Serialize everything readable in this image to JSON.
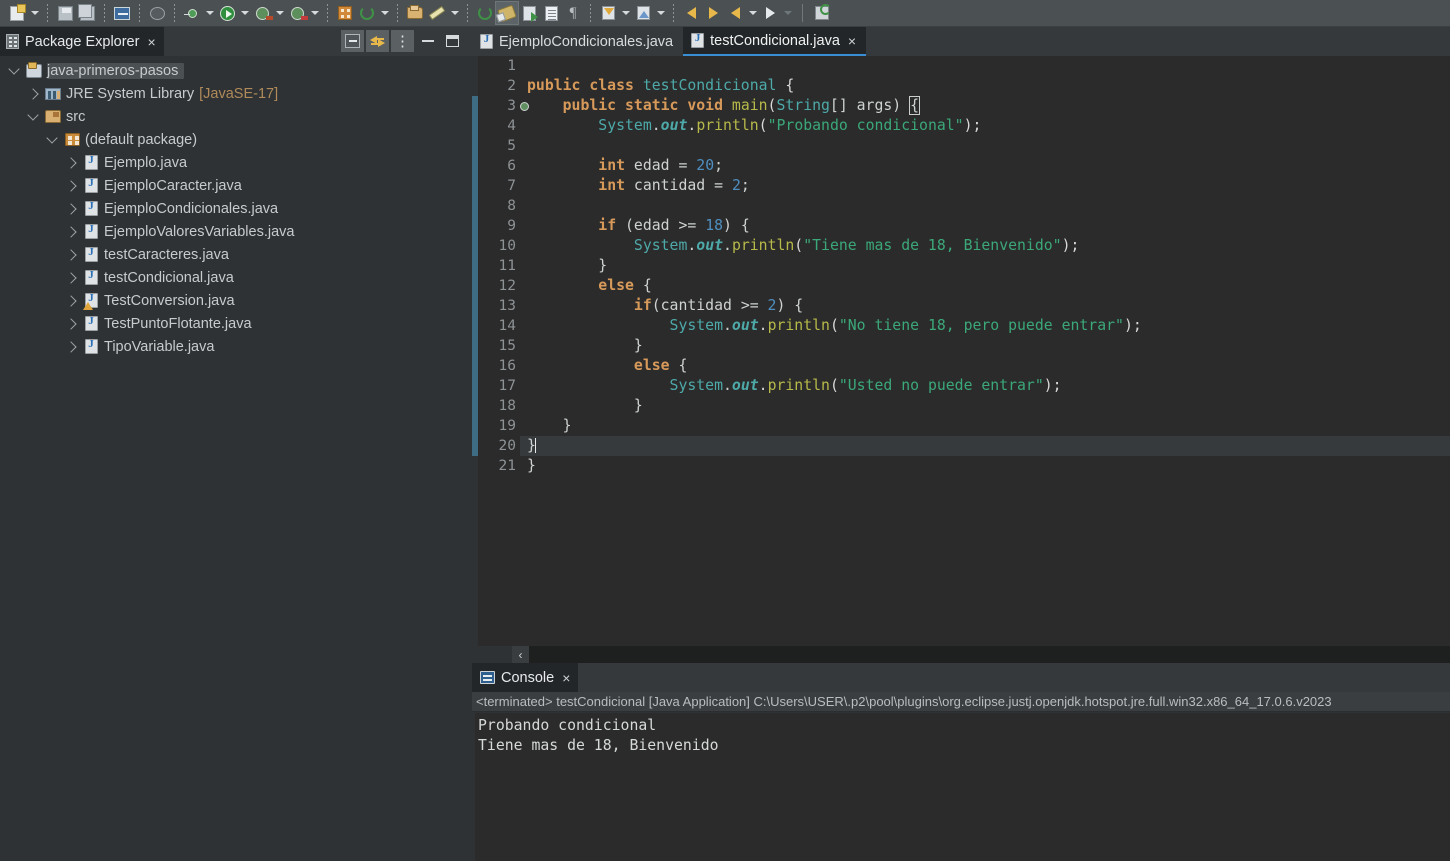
{
  "toolbar": {
    "groups": [
      {
        "items": [
          {
            "name": "new-wizard-icon",
            "kind": "file-new",
            "dropdown": true
          }
        ]
      },
      {
        "items": [
          {
            "name": "save-icon",
            "kind": "save",
            "dropdown": false
          },
          {
            "name": "save-all-icon",
            "kind": "save-all",
            "dropdown": false
          }
        ]
      },
      {
        "items": [
          {
            "name": "new-java-class-icon",
            "kind": "rect-blue",
            "dropdown": false
          }
        ]
      },
      {
        "items": [
          {
            "name": "skip-breakpoints-icon",
            "kind": "skip-bp",
            "dropdown": false
          }
        ]
      },
      {
        "items": [
          {
            "name": "debug-icon",
            "kind": "tiny-green",
            "dropdown": true
          },
          {
            "name": "run-icon",
            "kind": "run",
            "dropdown": true
          },
          {
            "name": "run-external-tools-icon",
            "kind": "debug-red",
            "dropdown": true
          },
          {
            "name": "coverage-icon",
            "kind": "debug-red2",
            "dropdown": true
          }
        ]
      },
      {
        "items": [
          {
            "name": "new-java-project-icon",
            "kind": "orange-grid",
            "dropdown": false
          },
          {
            "name": "refresh-icon",
            "kind": "refresh",
            "dropdown": true
          }
        ]
      },
      {
        "items": [
          {
            "name": "open-type-icon",
            "kind": "open-folder",
            "dropdown": false
          },
          {
            "name": "open-task-icon",
            "kind": "brush",
            "dropdown": true
          }
        ]
      },
      {
        "items": [
          {
            "name": "search-icon",
            "kind": "search-green",
            "dropdown": false
          },
          {
            "name": "toggle-mark-occurrences-icon",
            "kind": "paint",
            "dropdown": false,
            "selected": true
          },
          {
            "name": "next-annotation-icon",
            "kind": "doc-arrow",
            "dropdown": false
          },
          {
            "name": "show-whitespace-icon",
            "kind": "doc-white",
            "dropdown": false
          },
          {
            "name": "toggle-block-selection-icon",
            "kind": "pilcrow",
            "dropdown": false
          }
        ]
      },
      {
        "items": [
          {
            "name": "next-annotation-down-icon",
            "kind": "annot-down",
            "dropdown": true
          },
          {
            "name": "previous-annotation-up-icon",
            "kind": "annot-up",
            "dropdown": true
          }
        ]
      },
      {
        "items": [
          {
            "name": "back-history-icon",
            "kind": "arrow-yellow-left-glow",
            "dropdown": false
          },
          {
            "name": "forward-history-icon",
            "kind": "arrow-yellow-right-glow",
            "dropdown": false
          },
          {
            "name": "previous-edit-location-icon",
            "kind": "arrow-yellow-left",
            "dropdown": true
          },
          {
            "name": "next-edit-location-icon",
            "kind": "arrow-white-right",
            "dropdown": true,
            "dropdownDim": true
          }
        ]
      },
      {
        "separatorSolid": true,
        "items": [
          {
            "name": "open-perspective-icon",
            "kind": "green-annot",
            "dropdown": false
          }
        ]
      }
    ]
  },
  "package_explorer": {
    "tab_label": "Package Explorer",
    "tab_close": "×",
    "tools": [
      {
        "name": "collapse-all-button",
        "kind": "collapse",
        "boxed": true
      },
      {
        "name": "link-with-editor-button",
        "kind": "link",
        "boxed": true
      },
      {
        "name": "view-menu-button",
        "kind": "kebab",
        "boxed": true
      },
      {
        "name": "minimize-view-button",
        "kind": "minimize",
        "boxed": false
      },
      {
        "name": "maximize-view-button",
        "kind": "maximize",
        "boxed": false
      }
    ],
    "tree": [
      {
        "label": "java-primeros-pasos",
        "icon": "project",
        "indent": 0,
        "twisty": "down",
        "selected": true
      },
      {
        "label": "JRE System Library",
        "suffix": "[JavaSE-17]",
        "icon": "jre",
        "indent": 1,
        "twisty": "right",
        "selected": false
      },
      {
        "label": "src",
        "icon": "src-folder",
        "indent": 1,
        "twisty": "down",
        "selected": false
      },
      {
        "label": "(default package)",
        "icon": "package",
        "indent": 2,
        "twisty": "down",
        "selected": false
      },
      {
        "label": "Ejemplo.java",
        "icon": "java",
        "indent": 3,
        "twisty": "right",
        "selected": false
      },
      {
        "label": "EjemploCaracter.java",
        "icon": "java",
        "indent": 3,
        "twisty": "right",
        "selected": false
      },
      {
        "label": "EjemploCondicionales.java",
        "icon": "java",
        "indent": 3,
        "twisty": "right",
        "selected": false
      },
      {
        "label": "EjemploValoresVariables.java",
        "icon": "java",
        "indent": 3,
        "twisty": "right",
        "selected": false
      },
      {
        "label": "testCaracteres.java",
        "icon": "java",
        "indent": 3,
        "twisty": "right",
        "selected": false
      },
      {
        "label": "testCondicional.java",
        "icon": "java",
        "indent": 3,
        "twisty": "right",
        "selected": false
      },
      {
        "label": "TestConversion.java",
        "icon": "java-warning",
        "indent": 3,
        "twisty": "right",
        "selected": false
      },
      {
        "label": "TestPuntoFlotante.java",
        "icon": "java",
        "indent": 3,
        "twisty": "right",
        "selected": false
      },
      {
        "label": "TipoVariable.java",
        "icon": "java",
        "indent": 3,
        "twisty": "right",
        "selected": false
      }
    ]
  },
  "editor": {
    "tabs": [
      {
        "label": "EjemploCondicionales.java",
        "active": false,
        "closable": false
      },
      {
        "label": "testCondicional.java",
        "active": true,
        "closable": true,
        "close": "×"
      }
    ],
    "line_numbers": [
      "1",
      "2",
      "3",
      "4",
      "5",
      "6",
      "7",
      "8",
      "9",
      "10",
      "11",
      "12",
      "13",
      "14",
      "15",
      "16",
      "17",
      "18",
      "19",
      "20",
      "21"
    ],
    "marker_line": 3,
    "current_line": 20,
    "scroll_left_arrow": "‹",
    "lines": [
      {
        "n": 1,
        "tokens": []
      },
      {
        "n": 2,
        "tokens": [
          {
            "t": "public ",
            "c": "k"
          },
          {
            "t": "class ",
            "c": "k"
          },
          {
            "t": "testCondicional",
            "c": "ty"
          },
          {
            "t": " {",
            "c": "br"
          }
        ]
      },
      {
        "n": 3,
        "tokens": [
          {
            "t": "    ",
            "c": "pl"
          },
          {
            "t": "public ",
            "c": "k"
          },
          {
            "t": "static ",
            "c": "k"
          },
          {
            "t": "void ",
            "c": "k"
          },
          {
            "t": "main",
            "c": "mt"
          },
          {
            "t": "(",
            "c": "br"
          },
          {
            "t": "String",
            "c": "ty"
          },
          {
            "t": "[] args) ",
            "c": "pl"
          },
          {
            "t": "{",
            "c": "mbox"
          }
        ]
      },
      {
        "n": 4,
        "tokens": [
          {
            "t": "        ",
            "c": "pl"
          },
          {
            "t": "System",
            "c": "ty"
          },
          {
            "t": ".",
            "c": "pl"
          },
          {
            "t": "out",
            "c": "fl"
          },
          {
            "t": ".",
            "c": "pl"
          },
          {
            "t": "println",
            "c": "mt"
          },
          {
            "t": "(",
            "c": "br"
          },
          {
            "t": "\"Probando condicional\"",
            "c": "st"
          },
          {
            "t": ");",
            "c": "br"
          }
        ]
      },
      {
        "n": 5,
        "tokens": []
      },
      {
        "n": 6,
        "tokens": [
          {
            "t": "        ",
            "c": "pl"
          },
          {
            "t": "int ",
            "c": "k"
          },
          {
            "t": "edad",
            "c": "pl"
          },
          {
            "t": " = ",
            "c": "pl"
          },
          {
            "t": "20",
            "c": "nu"
          },
          {
            "t": ";",
            "c": "pl"
          }
        ]
      },
      {
        "n": 7,
        "tokens": [
          {
            "t": "        ",
            "c": "pl"
          },
          {
            "t": "int ",
            "c": "k"
          },
          {
            "t": "cantidad",
            "c": "pl"
          },
          {
            "t": " = ",
            "c": "pl"
          },
          {
            "t": "2",
            "c": "nu"
          },
          {
            "t": ";",
            "c": "pl"
          }
        ]
      },
      {
        "n": 8,
        "tokens": []
      },
      {
        "n": 9,
        "tokens": [
          {
            "t": "        ",
            "c": "pl"
          },
          {
            "t": "if ",
            "c": "k"
          },
          {
            "t": "(edad >= ",
            "c": "pl"
          },
          {
            "t": "18",
            "c": "nu"
          },
          {
            "t": ") {",
            "c": "pl"
          }
        ]
      },
      {
        "n": 10,
        "tokens": [
          {
            "t": "            ",
            "c": "pl"
          },
          {
            "t": "System",
            "c": "ty"
          },
          {
            "t": ".",
            "c": "pl"
          },
          {
            "t": "out",
            "c": "fl"
          },
          {
            "t": ".",
            "c": "pl"
          },
          {
            "t": "println",
            "c": "mt"
          },
          {
            "t": "(",
            "c": "br"
          },
          {
            "t": "\"Tiene mas de 18, Bienvenido\"",
            "c": "st"
          },
          {
            "t": ");",
            "c": "br"
          }
        ]
      },
      {
        "n": 11,
        "tokens": [
          {
            "t": "        }",
            "c": "pl"
          }
        ]
      },
      {
        "n": 12,
        "tokens": [
          {
            "t": "        ",
            "c": "pl"
          },
          {
            "t": "else ",
            "c": "k"
          },
          {
            "t": "{",
            "c": "pl"
          }
        ]
      },
      {
        "n": 13,
        "tokens": [
          {
            "t": "            ",
            "c": "pl"
          },
          {
            "t": "if",
            "c": "k"
          },
          {
            "t": "(cantidad >= ",
            "c": "pl"
          },
          {
            "t": "2",
            "c": "nu"
          },
          {
            "t": ") {",
            "c": "pl"
          }
        ]
      },
      {
        "n": 14,
        "tokens": [
          {
            "t": "                ",
            "c": "pl"
          },
          {
            "t": "System",
            "c": "ty"
          },
          {
            "t": ".",
            "c": "pl"
          },
          {
            "t": "out",
            "c": "fl"
          },
          {
            "t": ".",
            "c": "pl"
          },
          {
            "t": "println",
            "c": "mt"
          },
          {
            "t": "(",
            "c": "br"
          },
          {
            "t": "\"No tiene 18, pero puede entrar\"",
            "c": "st"
          },
          {
            "t": ");",
            "c": "br"
          }
        ]
      },
      {
        "n": 15,
        "tokens": [
          {
            "t": "            }",
            "c": "pl"
          }
        ]
      },
      {
        "n": 16,
        "tokens": [
          {
            "t": "            ",
            "c": "pl"
          },
          {
            "t": "else ",
            "c": "k"
          },
          {
            "t": "{",
            "c": "pl"
          }
        ]
      },
      {
        "n": 17,
        "tokens": [
          {
            "t": "                ",
            "c": "pl"
          },
          {
            "t": "System",
            "c": "ty"
          },
          {
            "t": ".",
            "c": "pl"
          },
          {
            "t": "out",
            "c": "fl"
          },
          {
            "t": ".",
            "c": "pl"
          },
          {
            "t": "println",
            "c": "mt"
          },
          {
            "t": "(",
            "c": "br"
          },
          {
            "t": "\"Usted no puede entrar\"",
            "c": "st"
          },
          {
            "t": ");",
            "c": "br"
          }
        ]
      },
      {
        "n": 18,
        "tokens": [
          {
            "t": "            }",
            "c": "pl"
          }
        ]
      },
      {
        "n": 19,
        "tokens": [
          {
            "t": "    }",
            "c": "pl"
          }
        ]
      },
      {
        "n": 20,
        "tokens": [
          {
            "t": "}",
            "c": "pl"
          }
        ],
        "caret": true
      },
      {
        "n": 21,
        "tokens": [
          {
            "t": "}",
            "c": "pl"
          }
        ]
      }
    ]
  },
  "console": {
    "tab_label": "Console",
    "tab_close": "×",
    "status_line": "<terminated> testCondicional [Java Application] C:\\Users\\USER\\.p2\\pool\\plugins\\org.eclipse.justj.openjdk.hotspot.jre.full.win32.x86_64_17.0.6.v2023",
    "output": [
      "Probando condicional",
      "Tiene mas de 18, Bienvenido"
    ]
  },
  "colors": {
    "toolbar_bg": "#4b5053",
    "panel_bg": "#2f3234",
    "tab_bg": "#36393b",
    "active_tab_bg": "#232629",
    "editor_bg": "#2b2b2b",
    "active_tab_underline": "#3a8fd4",
    "keyword": "#d79a5a",
    "type": "#4ea9a9",
    "string": "#3ba87a",
    "number": "#4f8fc0",
    "method": "#b7b94a",
    "text": "#cfd2d2",
    "selection": "#4b5053"
  }
}
